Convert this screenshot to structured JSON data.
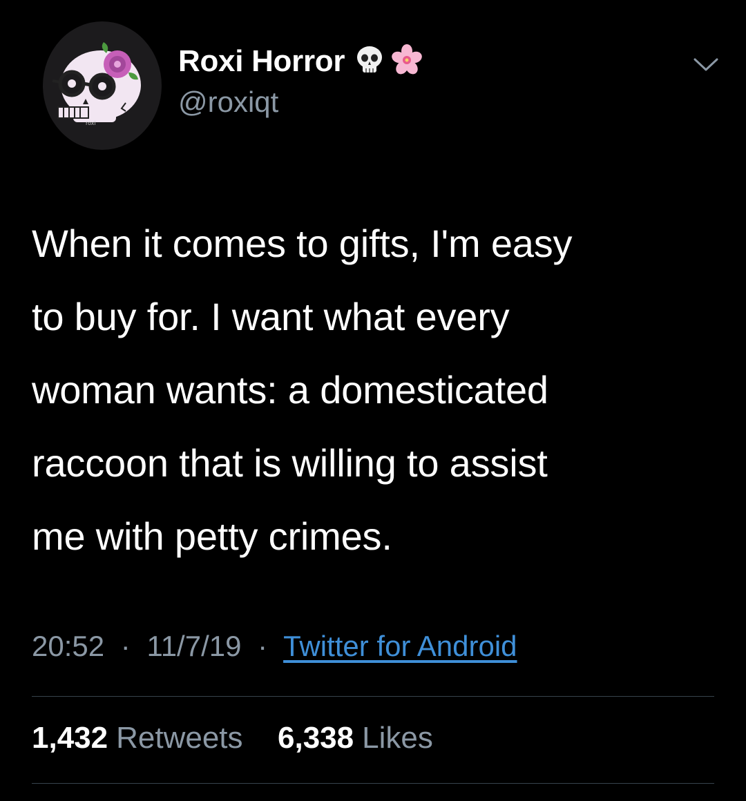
{
  "colors": {
    "background": "#000000",
    "text": "#ffffff",
    "secondary": "#8b98a5",
    "link": "#3f8fd8",
    "divider": "#38444d"
  },
  "author": {
    "display_name": "Roxi Horror",
    "handle": "@roxiqt",
    "name_emojis": [
      "skull-icon",
      "flower-icon"
    ],
    "avatar": "skull-with-flower-and-glasses-avatar"
  },
  "tweet": {
    "lines": [
      "When it comes to gifts, I'm easy",
      "to buy for. I want what every",
      "woman wants: a domesticated",
      "raccoon that is willing to assist",
      "me with petty crimes."
    ],
    "time": "20:52",
    "date": "11/7/19",
    "separator": "·",
    "source": "Twitter for Android"
  },
  "stats": {
    "retweets_count": "1,432",
    "retweets_label": "Retweets",
    "likes_count": "6,338",
    "likes_label": "Likes"
  }
}
